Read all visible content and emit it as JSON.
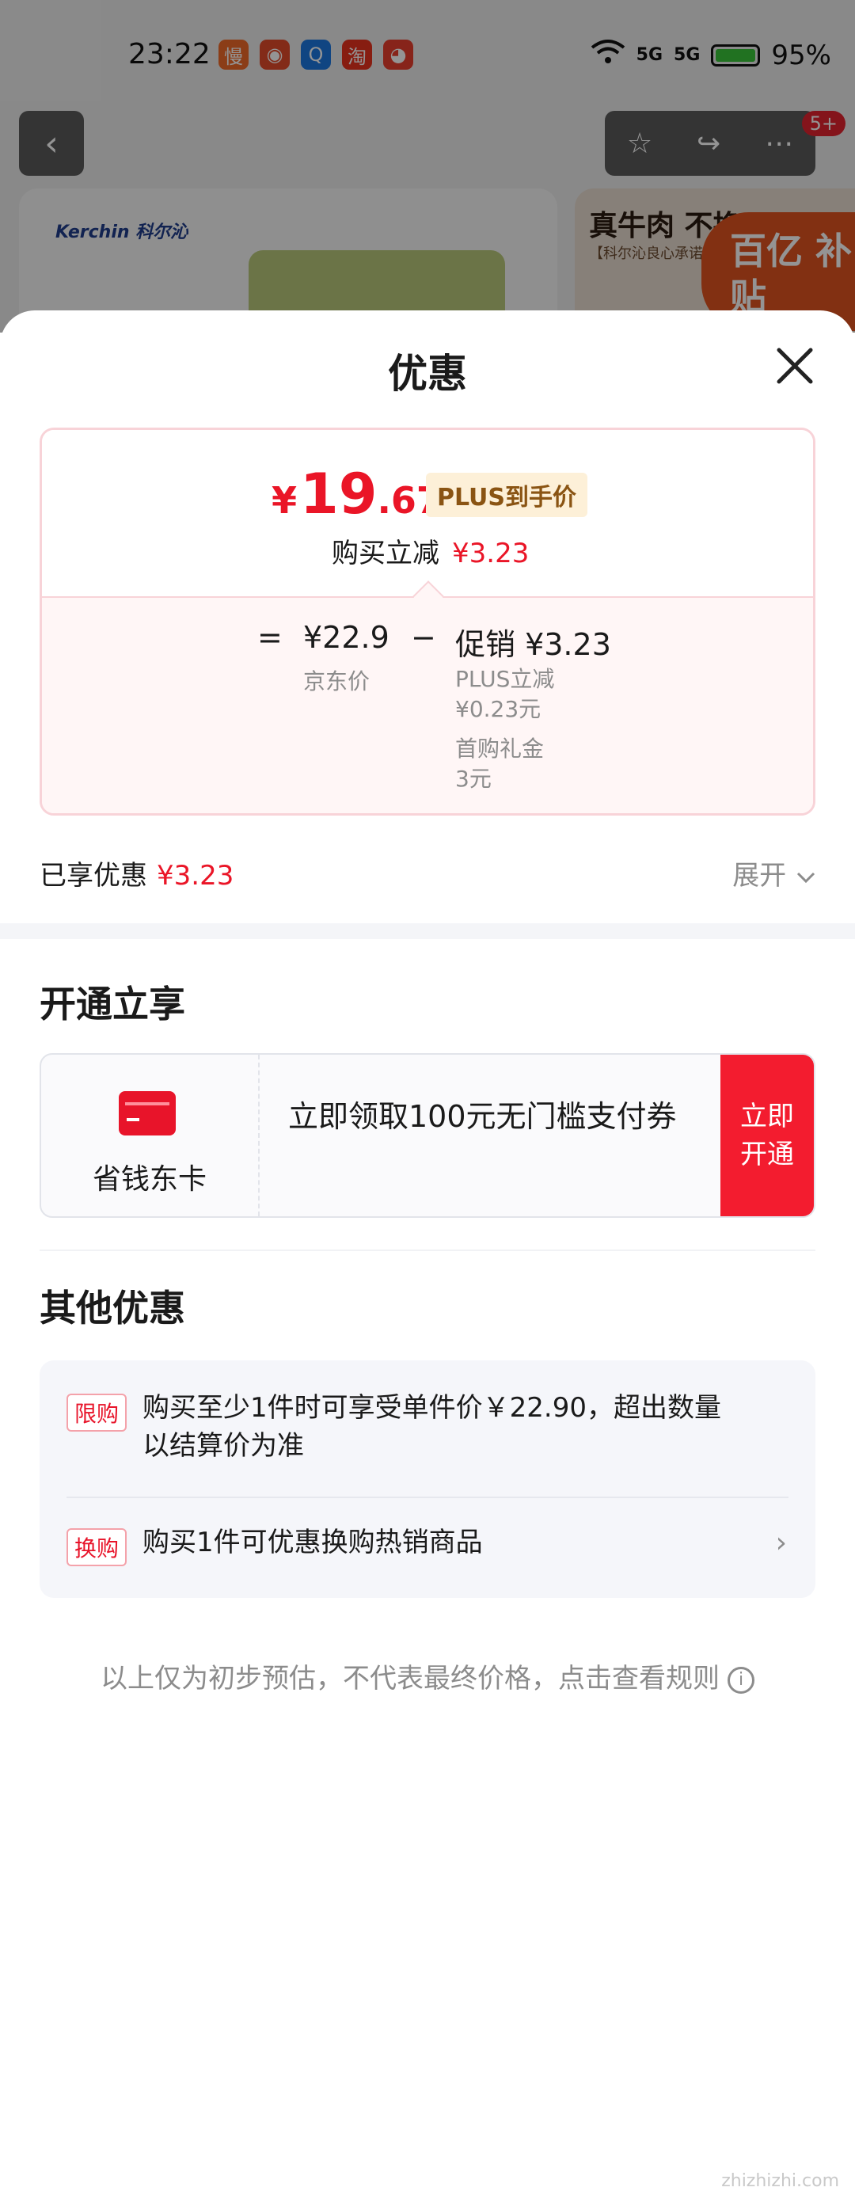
{
  "status_bar": {
    "time": "23:22",
    "apps": [
      {
        "icon": "mango-app-icon",
        "glyph": "慢",
        "color": "#f06a28"
      },
      {
        "icon": "bird-app-icon",
        "glyph": "◉",
        "color": "#e24a2a"
      },
      {
        "icon": "search-app-icon",
        "glyph": "Q",
        "color": "#1d78e0"
      },
      {
        "icon": "taobao-app-icon",
        "glyph": "淘",
        "color": "#e8321e"
      },
      {
        "icon": "cat-app-icon",
        "glyph": "◕",
        "color": "#e83e2e"
      }
    ],
    "signal_1": "5G",
    "signal_2": "5G",
    "battery": "95%"
  },
  "background": {
    "badge": "5+",
    "brand": "Kerchin 科尔沁",
    "banner_title": "真牛肉 不换",
    "banner_sub": "【科尔沁良心承诺】",
    "banner_badge": "百亿 补贴"
  },
  "sheet": {
    "title": "优惠",
    "price_card": {
      "currency": "¥",
      "price_int": "19",
      "price_dec": ".67",
      "plus_tag": "PLUS到手价",
      "buy_label": "购买立减",
      "buy_amount": "¥3.23",
      "eq": "=",
      "jd_price": "¥22.9",
      "jd_label": "京东价",
      "minus": "−",
      "promo": "促销 ¥3.23",
      "promo_lines": [
        "PLUS立减",
        "¥0.23元",
        "首购礼金",
        "3元"
      ]
    },
    "enjoyed_label": "已享优惠",
    "enjoyed_amount": "¥3.23",
    "expand_label": "展开",
    "open_section": {
      "title": "开通立享",
      "card_name": "省钱东卡",
      "card_desc": "立即领取100元无门槛支付券",
      "button": "立即开通"
    },
    "other_section": {
      "title": "其他优惠",
      "items": [
        {
          "tag": "限购",
          "text": "购买至少1件时可享受单件价￥22.90，超出数量以结算价为准"
        },
        {
          "tag": "换购",
          "text": "购买1件可优惠换购热销商品"
        }
      ]
    },
    "footer": "以上仅为初步预估，不代表最终价格，点击查看规则",
    "watermark": "zhizhizhi.com"
  }
}
